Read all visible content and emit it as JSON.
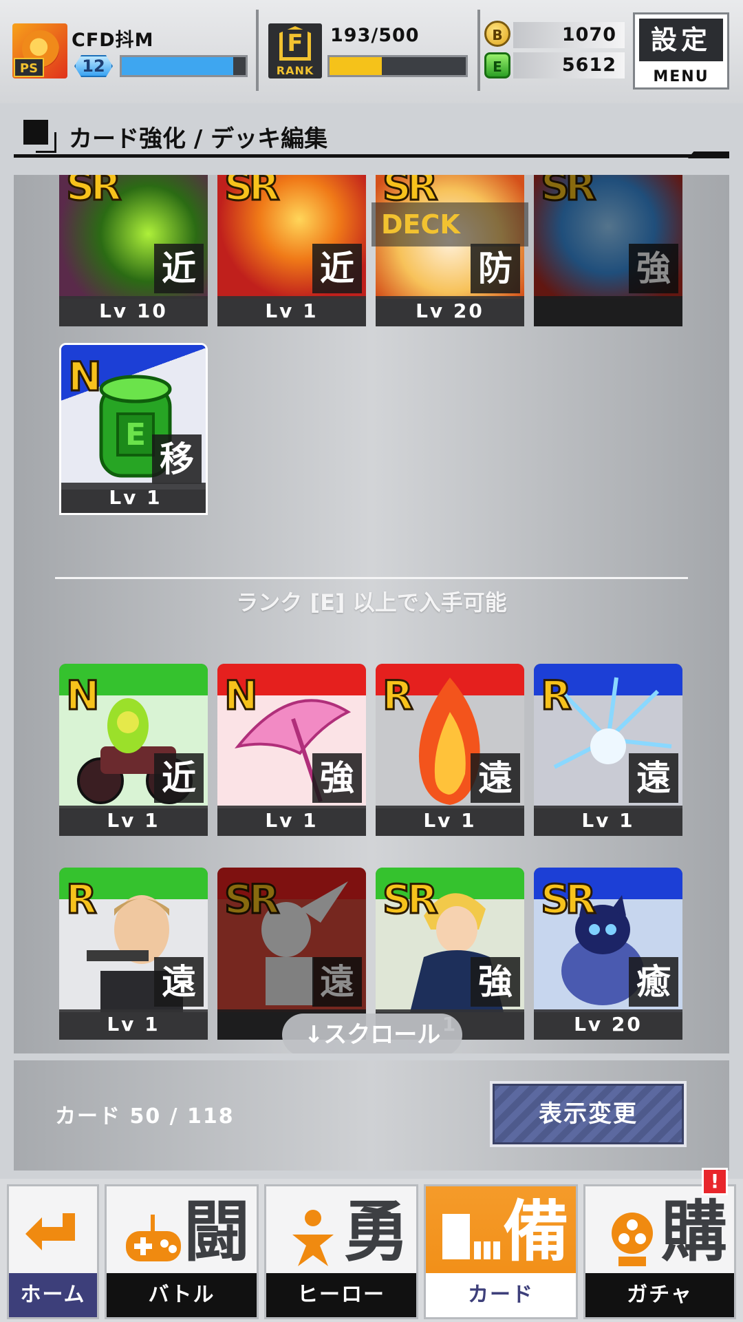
{
  "header": {
    "player_name": "CFD抖M",
    "player_level": "12",
    "level_progress": 0.9,
    "rank_label": "RANK",
    "rank_progress_text": "193/500",
    "rank_progress": 0.386,
    "coin_label": "B",
    "coin_value": "1070",
    "energy_label": "E",
    "energy_value": "5612",
    "menu_top": "設定",
    "menu_bottom": "MENU"
  },
  "page": {
    "title": "カード強化 / デッキ編集"
  },
  "deck_label": "DECK",
  "top_cards": [
    {
      "rarity": "SR",
      "type": "近",
      "level": "Lv 10"
    },
    {
      "rarity": "SR",
      "type": "近",
      "level": "Lv 1"
    },
    {
      "rarity": "SR",
      "type": "防",
      "level": "Lv 20"
    },
    {
      "rarity": "SR",
      "type": "強",
      "level": ""
    },
    {
      "rarity": "N",
      "type": "移",
      "level": "Lv 1"
    }
  ],
  "section_label": "ランク [E] 以上で入手可能",
  "locked_cards": [
    {
      "rarity": "N",
      "type": "近",
      "level": "Lv 1"
    },
    {
      "rarity": "N",
      "type": "強",
      "level": "Lv 1"
    },
    {
      "rarity": "R",
      "type": "遠",
      "level": "Lv 1"
    },
    {
      "rarity": "R",
      "type": "遠",
      "level": "Lv 1"
    },
    {
      "rarity": "R",
      "type": "遠",
      "level": "Lv 1"
    },
    {
      "rarity": "SR",
      "type": "遠",
      "level": ""
    },
    {
      "rarity": "SR",
      "type": "強",
      "level": "1"
    },
    {
      "rarity": "SR",
      "type": "癒",
      "level": "Lv 20"
    }
  ],
  "scroll_hint": "↓スクロール",
  "card_count": "カード 50 / 118",
  "display_change": "表示変更",
  "nav": [
    {
      "kanji": "",
      "label": "ホーム",
      "icon": "return-arrow-icon"
    },
    {
      "kanji": "闘",
      "label": "バトル",
      "icon": "gamepad-icon"
    },
    {
      "kanji": "勇",
      "label": "ヒーロー",
      "icon": "hero-icon"
    },
    {
      "kanji": "備",
      "label": "カード",
      "icon": "cards-icon"
    },
    {
      "kanji": "購",
      "label": "ガチャ",
      "icon": "gacha-icon"
    }
  ],
  "gacha_alert": "!",
  "colors": {
    "accent_orange": "#f08a10",
    "level_bar": "#3ea6f0",
    "rank_bar": "#f5c21a",
    "frame_green": "#35c22e",
    "frame_red": "#e5201e",
    "frame_blue": "#1c3fd6"
  }
}
